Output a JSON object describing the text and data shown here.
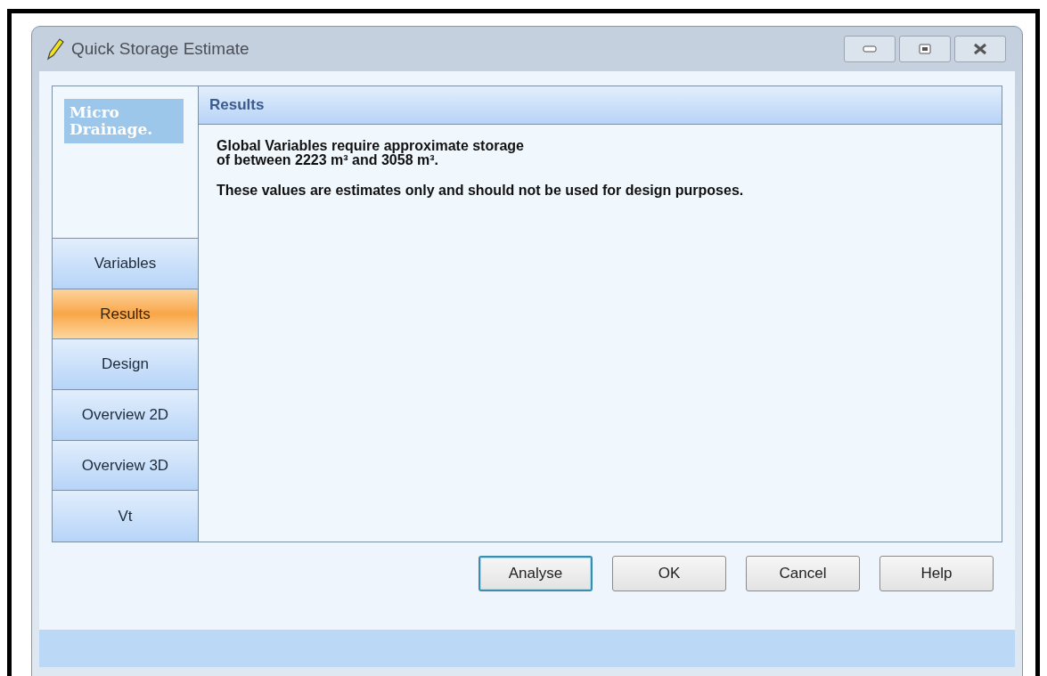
{
  "window": {
    "title": "Quick Storage Estimate"
  },
  "logo": {
    "line_1": "Micro",
    "line_2": "Drainage."
  },
  "nav": [
    {
      "label": "Variables",
      "selected": false
    },
    {
      "label": "Results",
      "selected": true
    },
    {
      "label": "Design",
      "selected": false
    },
    {
      "label": "Overview 2D",
      "selected": false
    },
    {
      "label": "Overview 3D",
      "selected": false
    },
    {
      "label": "Vt",
      "selected": false
    }
  ],
  "panel": {
    "title": "Results",
    "paragraphs": [
      "Global Variables require approximate storage\nof between 2223 m³ and 3058 m³.",
      "These values are estimates only and should not be used for design purposes."
    ]
  },
  "buttons": [
    {
      "label": "Analyse",
      "focused": true
    },
    {
      "label": "OK",
      "focused": false
    },
    {
      "label": "Cancel",
      "focused": false
    },
    {
      "label": "Help",
      "focused": false
    }
  ]
}
